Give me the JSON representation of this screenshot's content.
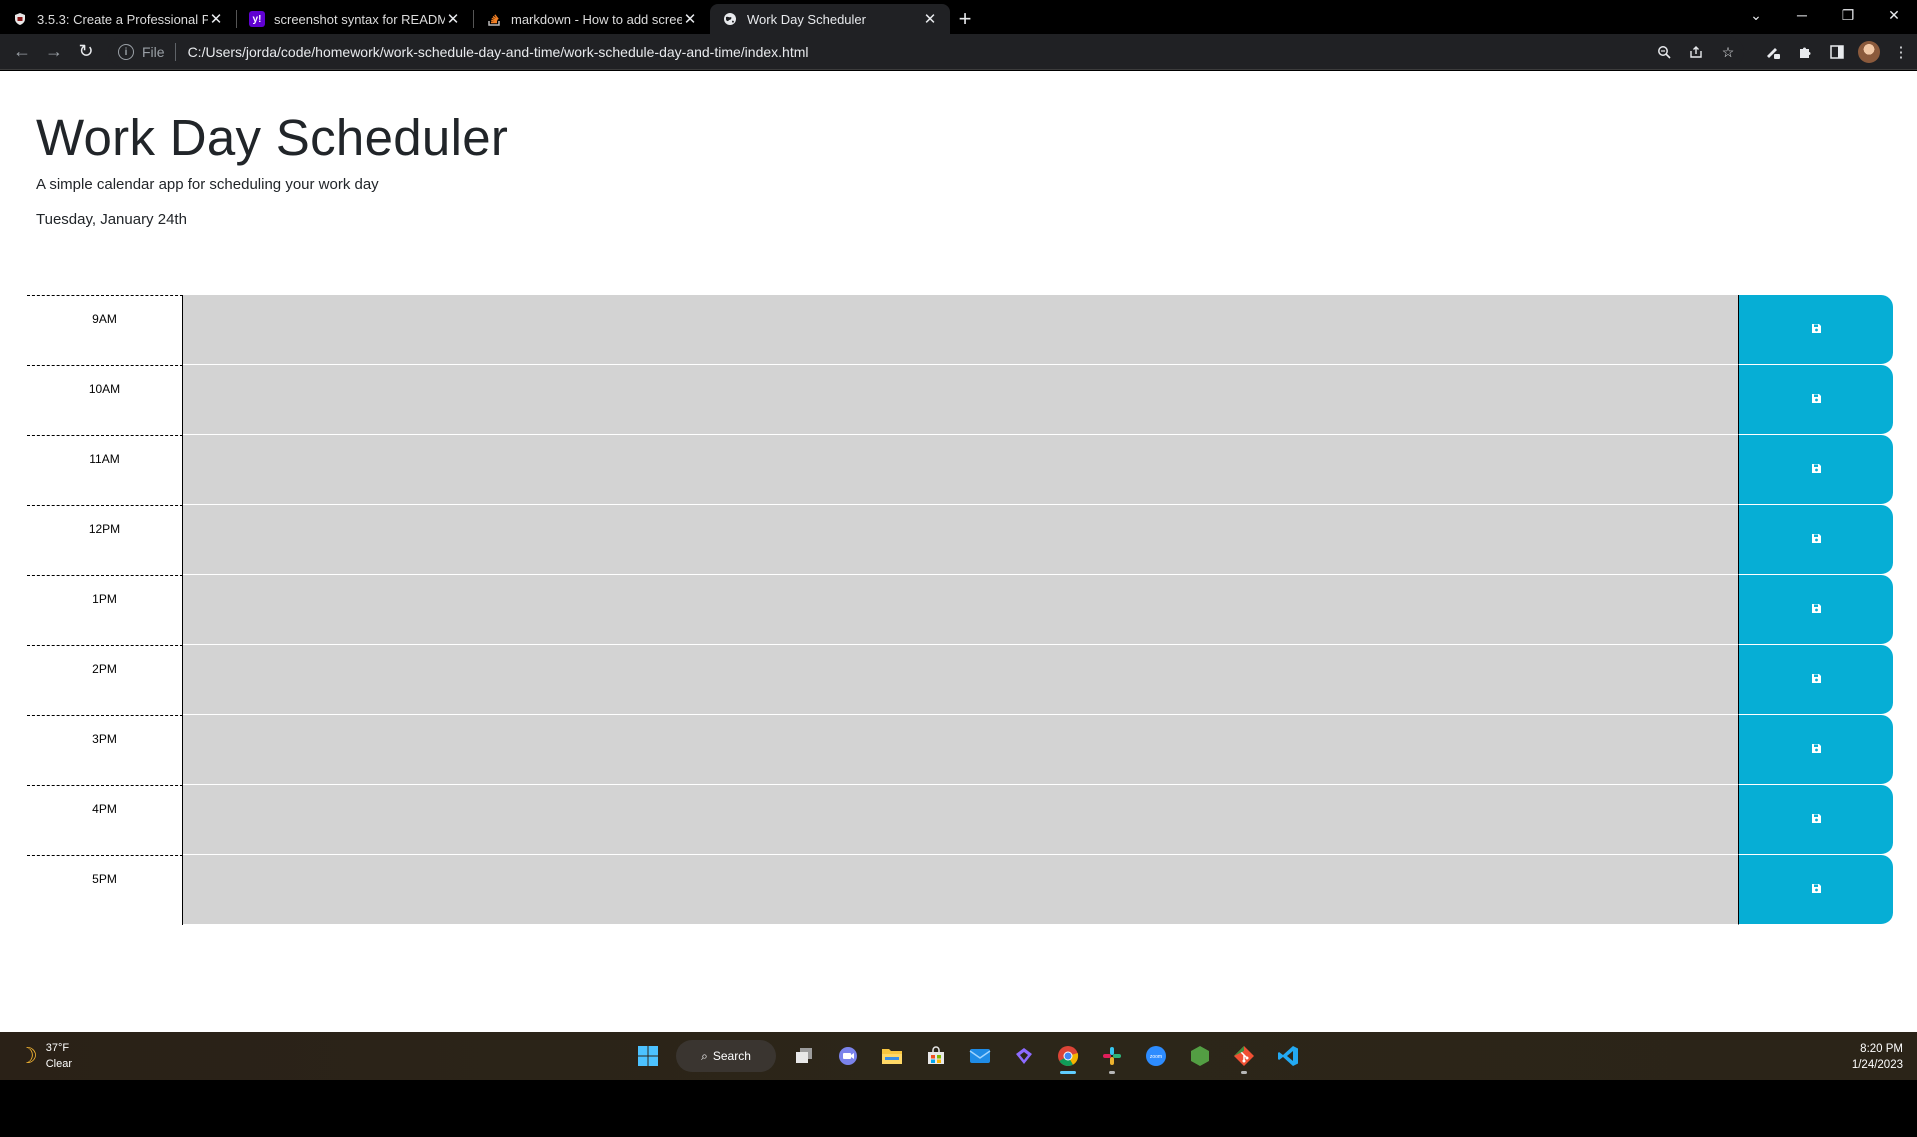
{
  "browser": {
    "tabs": [
      {
        "title": "3.5.3: Create a Professional Proje",
        "icon": "university-shield-icon",
        "active": false
      },
      {
        "title": "screenshot syntax for READMES",
        "icon": "yahoo-icon",
        "active": false
      },
      {
        "title": "markdown - How to add screens",
        "icon": "stackoverflow-icon",
        "active": false
      },
      {
        "title": "Work Day Scheduler",
        "icon": "globe-icon",
        "active": true
      }
    ],
    "address": {
      "scheme": "File",
      "url": "C:/Users/jorda/code/homework/work-schedule-day-and-time/work-schedule-day-and-time/index.html"
    }
  },
  "page": {
    "title": "Work Day Scheduler",
    "lead": "A simple calendar app for scheduling your work day",
    "current_day": "Tuesday, January 24th",
    "hours": [
      {
        "label": "9AM",
        "text": ""
      },
      {
        "label": "10AM",
        "text": ""
      },
      {
        "label": "11AM",
        "text": ""
      },
      {
        "label": "12PM",
        "text": ""
      },
      {
        "label": "1PM",
        "text": ""
      },
      {
        "label": "2PM",
        "text": ""
      },
      {
        "label": "3PM",
        "text": ""
      },
      {
        "label": "4PM",
        "text": ""
      },
      {
        "label": "5PM",
        "text": ""
      }
    ],
    "colors": {
      "past": "#d3d3d3",
      "save_button": "#06aed5"
    }
  },
  "taskbar": {
    "weather": {
      "temp": "37°F",
      "condition": "Clear"
    },
    "search_label": "Search",
    "time": "8:20 PM",
    "date": "1/24/2023"
  }
}
